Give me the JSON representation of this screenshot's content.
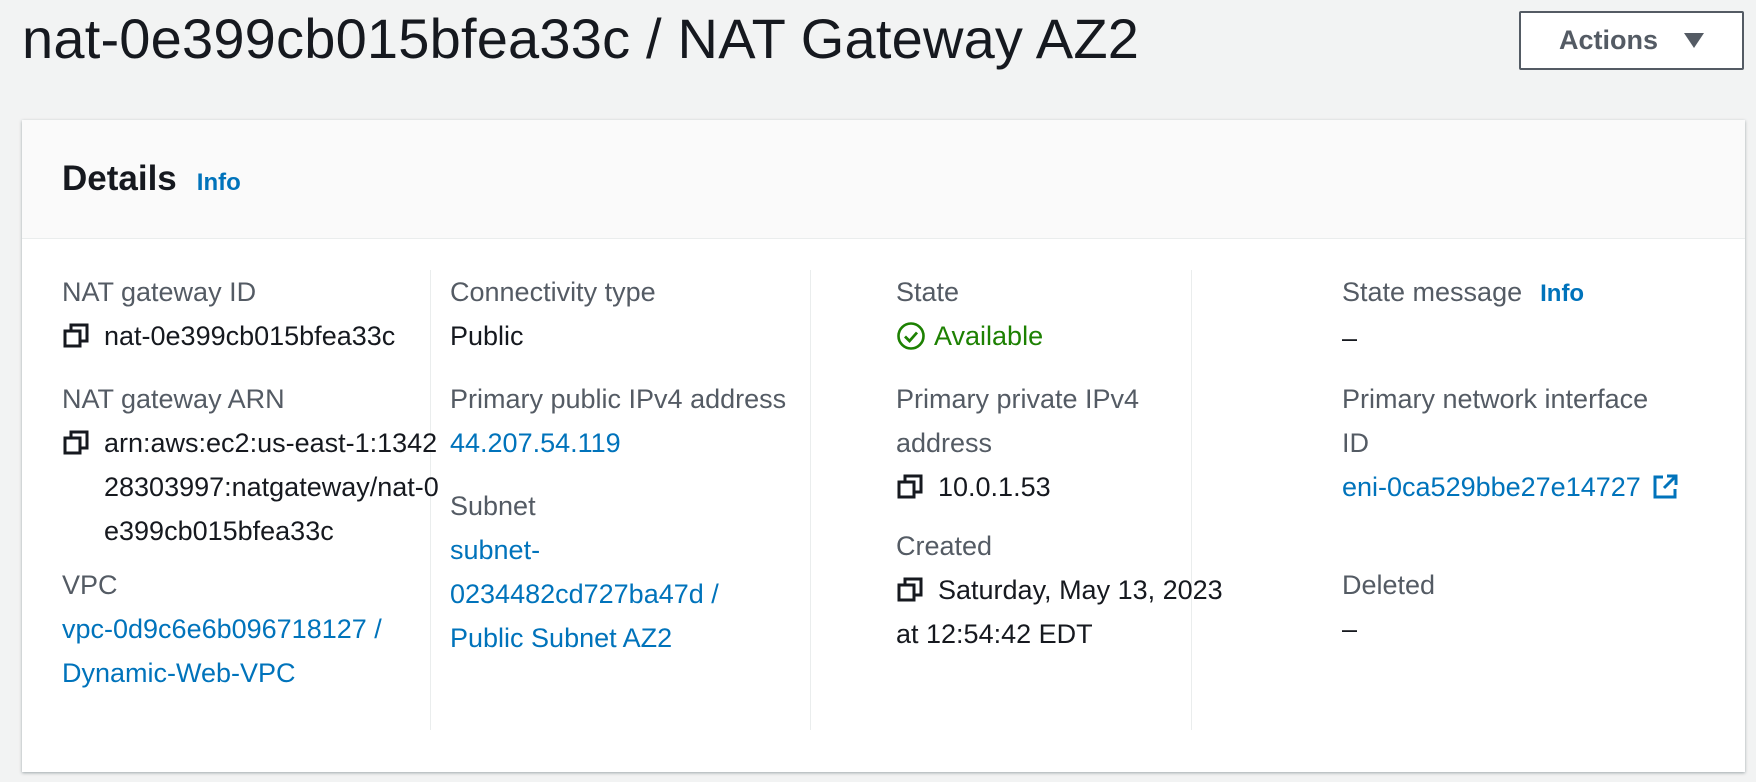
{
  "page": {
    "title": "nat-0e399cb015bfea33c / NAT Gateway AZ2",
    "actions_label": "Actions"
  },
  "details": {
    "title": "Details",
    "info_label": "Info",
    "nat_gateway_id": {
      "label": "NAT gateway ID",
      "value": "nat-0e399cb015bfea33c"
    },
    "nat_gateway_arn": {
      "label": "NAT gateway ARN",
      "value": "arn:aws:ec2:us-east-1:134228303997:natgateway/nat-0e399cb015bfea33c"
    },
    "vpc": {
      "label": "VPC",
      "value": "vpc-0d9c6e6b096718127 / Dynamic-Web-VPC"
    },
    "connectivity_type": {
      "label": "Connectivity type",
      "value": "Public"
    },
    "primary_public_ipv4": {
      "label": "Primary public IPv4 address",
      "value": "44.207.54.119"
    },
    "subnet": {
      "label": "Subnet",
      "value": "subnet-0234482cd727ba47d / Public Subnet AZ2"
    },
    "state": {
      "label": "State",
      "value": "Available",
      "color": "#1d8102"
    },
    "primary_private_ipv4": {
      "label": "Primary private IPv4 address",
      "value": "10.0.1.53"
    },
    "created": {
      "label": "Created",
      "value": "Saturday, May 13, 2023 at 12:54:42 EDT"
    },
    "state_message": {
      "label": "State message",
      "info_label": "Info",
      "value": "–"
    },
    "primary_network_interface": {
      "label": "Primary network interface ID",
      "value": "eni-0ca529bbe27e14727"
    },
    "deleted": {
      "label": "Deleted",
      "value": "–"
    }
  },
  "colors": {
    "link": "#0073bb",
    "success": "#1d8102",
    "label": "#545b64",
    "text": "#16191f"
  },
  "icons": [
    "caret-down-icon",
    "copy-icon",
    "check-circle-icon",
    "external-link-icon"
  ]
}
